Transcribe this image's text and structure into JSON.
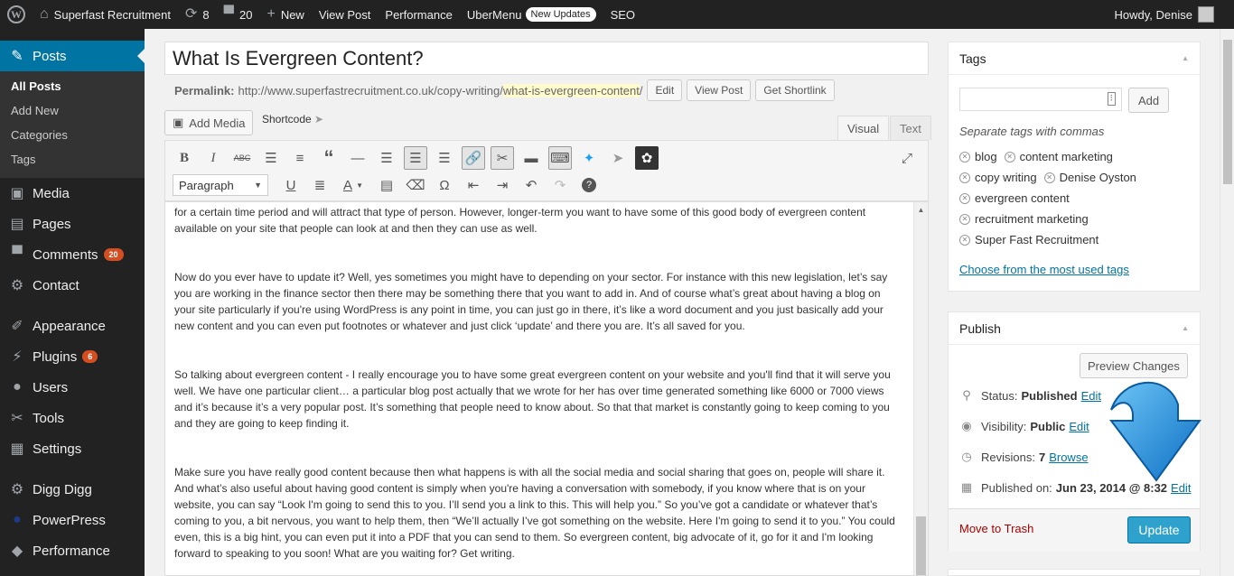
{
  "adminbar": {
    "site_name": "Superfast Recruitment",
    "updates_count": "8",
    "comments_count": "20",
    "new_label": "New",
    "view_post": "View Post",
    "performance": "Performance",
    "ubermenu": "UberMenu",
    "new_updates": "New Updates",
    "seo": "SEO",
    "howdy": "Howdy, Denise"
  },
  "sidebar": {
    "posts": "Posts",
    "submenu": [
      "All Posts",
      "Add New",
      "Categories",
      "Tags"
    ],
    "media": "Media",
    "pages": "Pages",
    "comments": "Comments",
    "comments_badge": "20",
    "contact": "Contact",
    "appearance": "Appearance",
    "plugins": "Plugins",
    "plugins_badge": "6",
    "users": "Users",
    "tools": "Tools",
    "settings": "Settings",
    "digg_digg": "Digg Digg",
    "powerpress": "PowerPress",
    "performance": "Performance"
  },
  "editor": {
    "title": "What Is Evergreen Content?",
    "permalink_label": "Permalink:",
    "permalink_base": "http://www.superfastrecruitment.co.uk/copy-writing/",
    "permalink_slug": "what-is-evergreen-content",
    "permalink_end": "/",
    "edit_btn": "Edit",
    "view_post_btn": "View Post",
    "shortlink_btn": "Get Shortlink",
    "add_media": "Add Media",
    "shortcode": "Shortcode",
    "tab_visual": "Visual",
    "tab_text": "Text",
    "format_select": "Paragraph",
    "paragraphs": [
      "for a certain time period and will attract that type of person. However, longer-term you want to have some of this good body of evergreen content available on your site that people can look at and then they can use as well.",
      "Now do you ever have to update it? Well, yes sometimes you might have to depending on your sector. For instance with this new legislation, let’s say you are working in the finance sector then there may be something there that you want to add in. And of course what’s great about having a blog on your site particularly if you're using WordPress is any point in time, you can just go in there, it’s like a word document and you just basically add your new content and you can even put footnotes or whatever and just click ‘update’ and there you are. It’s all saved for you.",
      "So talking about evergreen content - I really encourage you to have some great evergreen content on your website and you'll find that it will serve you well. We have one particular client… a particular blog post actually that we wrote for her has over time generated something like 6000 or 7000 views and it’s because it’s a very popular post. It’s something that people need to know about. So that that market is constantly going to keep coming to you and they are going to keep finding it.",
      "Make sure you have really good content because then what happens is with all the social media and social sharing that goes on, people will share it. And what’s also useful about having good content is simply when you're having a conversation with somebody, if you know where that is on your website, you can say “Look I'm going to send this to you. I’ll send you a link to this. This will help you.” So you’ve got a candidate or whatever that’s coming to you, a bit nervous, you want to help them, then “We’ll actually I’ve got something on the website. Here I'm going to send it to you.” You could even, this is a big hint, you can even put it into a PDF that you can send to them. So evergreen content, big advocate of it, go for it and I'm looking forward to speaking to you soon! What are you waiting for? Get writing."
    ]
  },
  "tags_box": {
    "title": "Tags",
    "add_btn": "Add",
    "hint": "Separate tags with commas",
    "tags": [
      "blog",
      "content marketing",
      "copy writing",
      "Denise Oyston",
      "evergreen content",
      "recruitment marketing",
      "Super Fast Recruitment"
    ],
    "most_used_link": "Choose from the most used tags"
  },
  "publish_box": {
    "title": "Publish",
    "preview_btn": "Preview Changes",
    "status_label": "Status:",
    "status_value": "Published",
    "status_edit": "Edit",
    "visibility_label": "Visibility:",
    "visibility_value": "Public",
    "visibility_edit": "Edit",
    "revisions_label": "Revisions:",
    "revisions_value": "7",
    "revisions_browse": "Browse",
    "published_label": "Published on:",
    "published_value": "Jun 23, 2014 @ 8:32",
    "published_edit": "Edit",
    "trash": "Move to Trash",
    "update_btn": "Update"
  },
  "colors": {
    "admin_bar": "#222222",
    "sidebar_current": "#0074a2",
    "update_button": "#2ea2cc",
    "arrow": "#1e8fd8",
    "badge": "#d54e21"
  }
}
